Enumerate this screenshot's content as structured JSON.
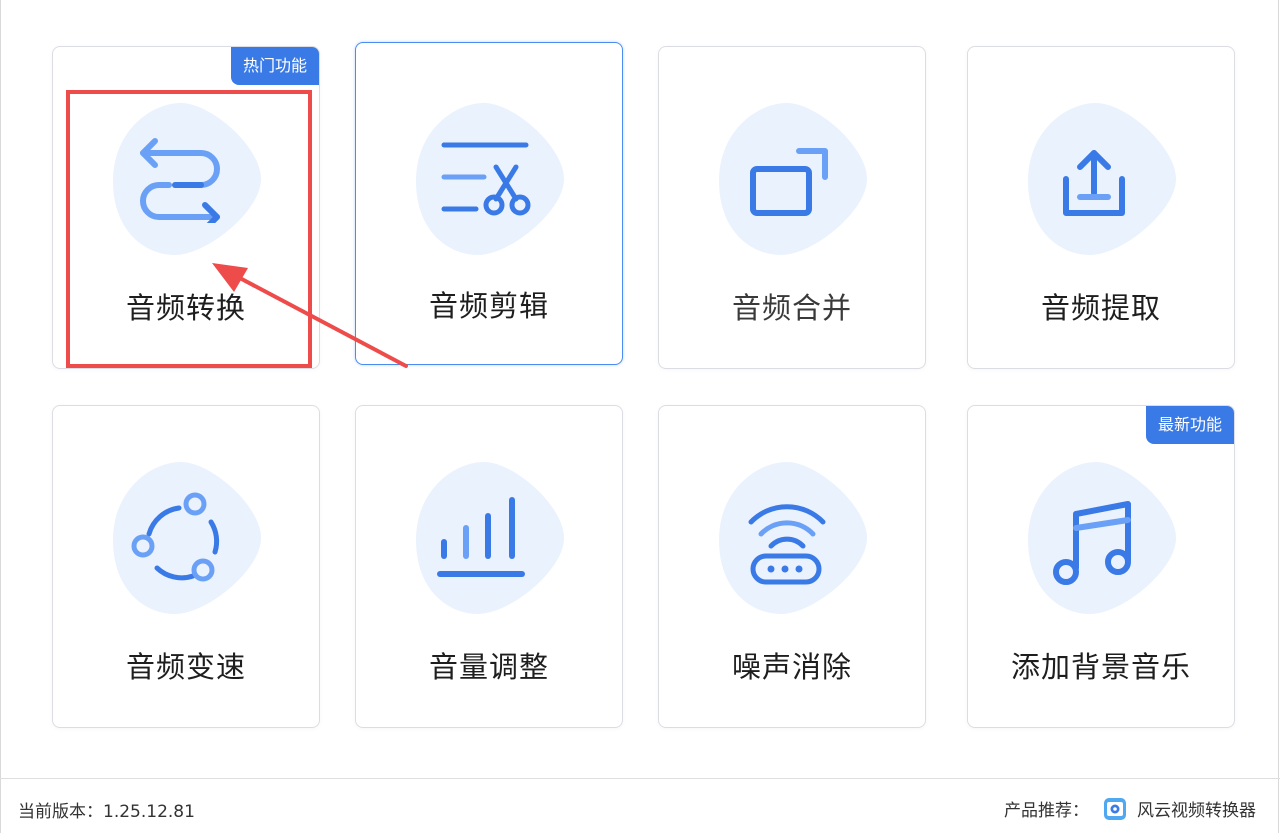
{
  "cards": [
    {
      "label": "音频转换",
      "badge": "热门功能",
      "icon": "convert-arrows-icon"
    },
    {
      "label": "音频剪辑",
      "badge": "",
      "icon": "scissors-icon"
    },
    {
      "label": "音频合并",
      "badge": "",
      "icon": "merge-windows-icon"
    },
    {
      "label": "音频提取",
      "badge": "",
      "icon": "export-upload-icon"
    },
    {
      "label": "音频变速",
      "badge": "",
      "icon": "speed-circle-icon"
    },
    {
      "label": "音量调整",
      "badge": "",
      "icon": "volume-bars-icon"
    },
    {
      "label": "噪声消除",
      "badge": "",
      "icon": "noise-reduction-icon"
    },
    {
      "label": "添加背景音乐",
      "badge": "最新功能",
      "icon": "music-note-icon"
    }
  ],
  "footer": {
    "version": "当前版本：1.25.12.81",
    "recommend_label": "产品推荐：",
    "product_name": "风云视频转换器",
    "product_icon": "video-converter-app-icon"
  },
  "colors": {
    "accent": "#3a7ae6",
    "icon_light": "#6aa0f5",
    "blob": "#eaf2fd",
    "annotation": "#ee4b4b"
  }
}
